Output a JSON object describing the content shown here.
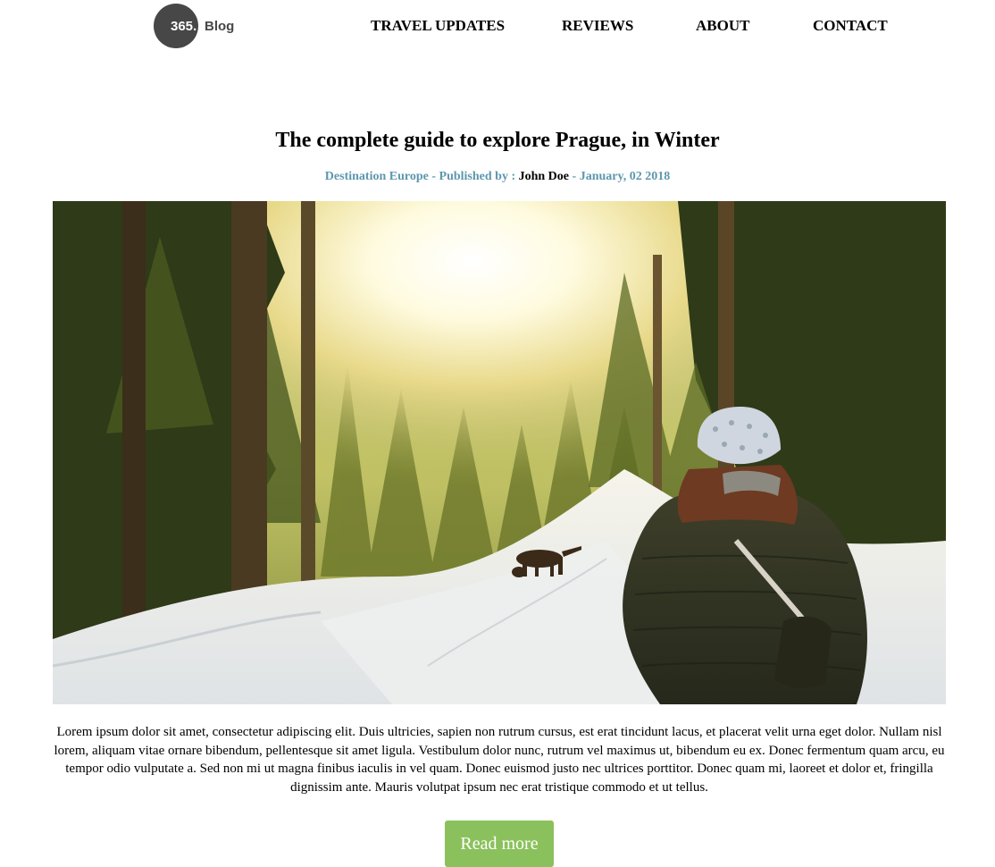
{
  "header": {
    "logo": {
      "mark": "365.",
      "text": "Blog"
    },
    "nav": [
      {
        "label": "TRAVEL UPDATES"
      },
      {
        "label": "REVIEWS"
      },
      {
        "label": "ABOUT"
      },
      {
        "label": "CONTACT"
      }
    ]
  },
  "post": {
    "title": "The complete guide to explore Prague, in Winter",
    "meta": {
      "category": "Destination Europe",
      "separator": "-",
      "published_by_label": "Published by :",
      "author": "John Doe",
      "date": "January, 02 2018"
    },
    "image": {
      "subject": "woman-and-dog-in-snowy-forest"
    },
    "body": "Lorem ipsum dolor sit amet, consectetur adipiscing elit. Duis ultricies, sapien non rutrum cursus, est erat tincidunt lacus, et placerat velit urna eget dolor. Nullam nisl lorem, aliquam vitae ornare bibendum, pellentesque sit amet ligula. Vestibulum dolor nunc, rutrum vel maximus ut, bibendum eu ex. Donec fermentum quam arcu, eu tempor odio vulputate a. Sed non mi ut magna finibus iaculis in vel quam. Donec euismod justo nec ultrices porttitor. Donec quam mi, laoreet et dolor et, fringilla dignissim ante. Mauris volutpat ipsum nec erat tristique commodo et ut tellus.",
    "read_more_label": "Read more"
  },
  "colors": {
    "logo_bg": "#474747",
    "meta_accent": "#5d97ad",
    "button_bg": "#8bc15c",
    "button_text": "#ffffff"
  }
}
